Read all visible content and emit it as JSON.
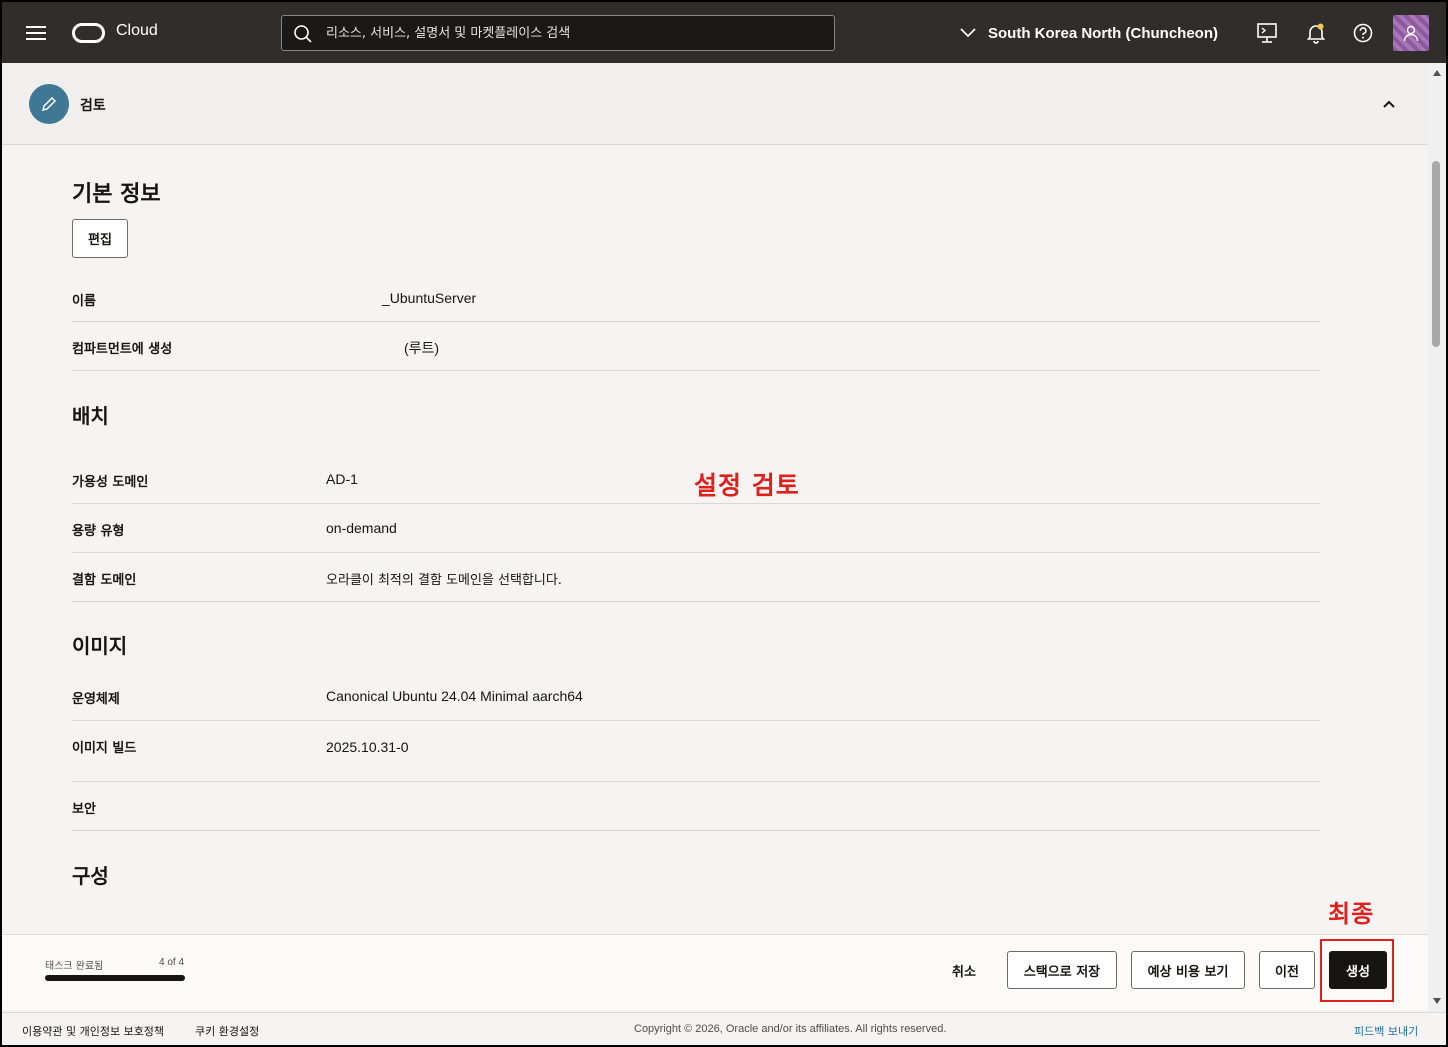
{
  "topbar": {
    "brand": "Cloud",
    "search_placeholder": "리소스, 서비스, 설명서 및 마켓플레이스 검색",
    "region": "South Korea North (Chuncheon)"
  },
  "review": {
    "title": "검토"
  },
  "basic": {
    "heading": "기본 정보",
    "edit_label": "편집",
    "rows": [
      {
        "label": "이름",
        "value": "_UbuntuServer"
      },
      {
        "label": "컴파트먼트에 생성",
        "value": "(루트)"
      }
    ]
  },
  "placement": {
    "heading": "배치",
    "rows": [
      {
        "label": "가용성 도메인",
        "value": "AD-1"
      },
      {
        "label": "용량 유형",
        "value": "on-demand"
      },
      {
        "label": "결함 도메인",
        "value": "오라클이 최적의 결함 도메인을 선택합니다."
      }
    ]
  },
  "image": {
    "heading": "이미지",
    "rows": [
      {
        "label": "운영체제",
        "value": "Canonical Ubuntu 24.04 Minimal aarch64"
      },
      {
        "label": "이미지 빌드",
        "value": "2025.10.31-0"
      },
      {
        "label": "보안",
        "value": ""
      }
    ]
  },
  "shape": {
    "heading": "구성"
  },
  "annotations": {
    "review_settings": "설정 검토",
    "final": "최종"
  },
  "actions": {
    "task_label": "태스크 완료됨",
    "task_count": "4 of 4",
    "progress": 1.0,
    "cancel": "취소",
    "save_stack": "스택으로 저장",
    "estimate_cost": "예상 비용 보기",
    "previous": "이전",
    "create": "생성"
  },
  "footer": {
    "terms": "이용약관 및 개인정보 보호정책",
    "cookies": "쿠키 환경설정",
    "copyright": "Copyright © 2026, Oracle and/or its affiliates. All rights reserved.",
    "feedback": "피드백 보내기"
  },
  "colors": {
    "topbar": "#312d2a",
    "annotation": "#e0201c",
    "primary_button": "#161513",
    "link": "#1e6fa8"
  }
}
